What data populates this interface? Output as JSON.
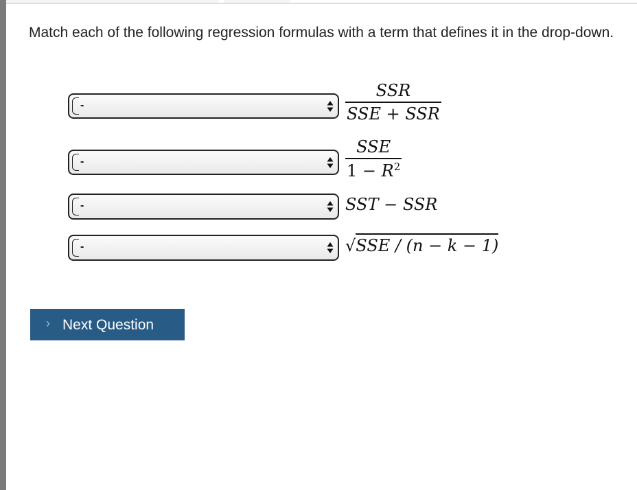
{
  "question": {
    "text": "Match each of the following regression formulas with a term that defines it in the drop-down."
  },
  "matches": [
    {
      "selected": "-",
      "formula": {
        "numerator": "SSR",
        "denominator": "SSE + SSR"
      }
    },
    {
      "selected": "-",
      "formula": {
        "numerator": "SSE",
        "denominator_prefix": "1 − ",
        "denominator_var": "R",
        "denominator_exp": "2"
      }
    },
    {
      "selected": "-",
      "formula": {
        "text": "SST − SSR"
      }
    },
    {
      "selected": "-",
      "formula": {
        "radical": "√",
        "radicand": "SSE / (n − k − 1)"
      }
    }
  ],
  "icons": {
    "select_arrows": "up-down-arrows-icon",
    "next_chevron": "chevron-right-icon"
  },
  "next_button": {
    "chevron": "›",
    "label": "Next Question"
  },
  "colors": {
    "button_bg": "#285c86",
    "button_text": "#ffffff"
  }
}
